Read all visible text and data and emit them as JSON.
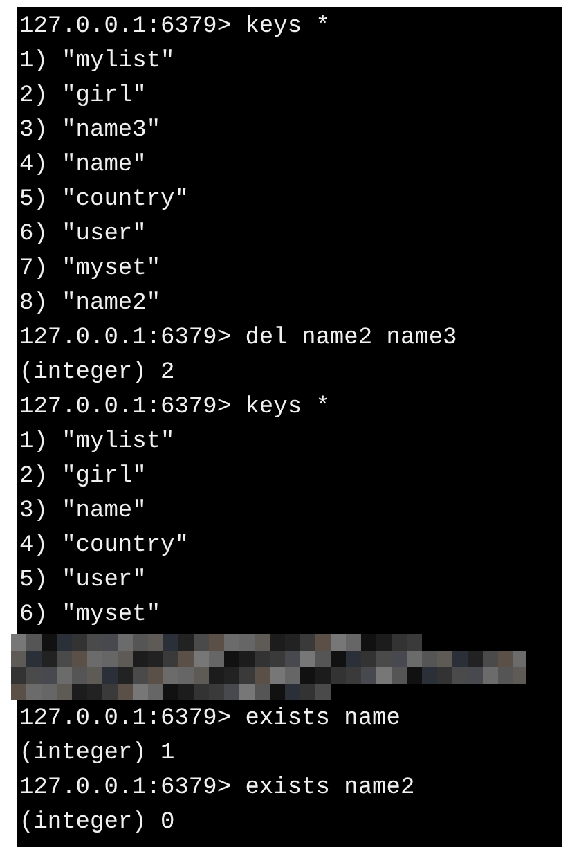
{
  "terminal": {
    "lines": [
      {
        "kind": "text",
        "text": "127.0.0.1:6379> keys *"
      },
      {
        "kind": "text",
        "text": "1) \"mylist\""
      },
      {
        "kind": "text",
        "text": "2) \"girl\""
      },
      {
        "kind": "text",
        "text": "3) \"name3\""
      },
      {
        "kind": "text",
        "text": "4) \"name\""
      },
      {
        "kind": "text",
        "text": "5) \"country\""
      },
      {
        "kind": "text",
        "text": "6) \"user\""
      },
      {
        "kind": "text",
        "text": "7) \"myset\""
      },
      {
        "kind": "text",
        "text": "8) \"name2\""
      },
      {
        "kind": "text",
        "text": "127.0.0.1:6379> del name2 name3"
      },
      {
        "kind": "text",
        "text": "(integer) 2"
      },
      {
        "kind": "text",
        "text": "127.0.0.1:6379> keys *"
      },
      {
        "kind": "text",
        "text": "1) \"mylist\""
      },
      {
        "kind": "text",
        "text": "2) \"girl\""
      },
      {
        "kind": "text",
        "text": "3) \"name\""
      },
      {
        "kind": "text",
        "text": "4) \"country\""
      },
      {
        "kind": "text",
        "text": "5) \"user\""
      },
      {
        "kind": "text",
        "text": "6) \"myset\""
      },
      {
        "kind": "redacted"
      },
      {
        "kind": "text",
        "text": "127.0.0.1:6379> exists name"
      },
      {
        "kind": "text",
        "text": "(integer) 1"
      },
      {
        "kind": "text",
        "text": "127.0.0.1:6379> exists name2"
      },
      {
        "kind": "text",
        "text": "(integer) 0"
      }
    ]
  }
}
